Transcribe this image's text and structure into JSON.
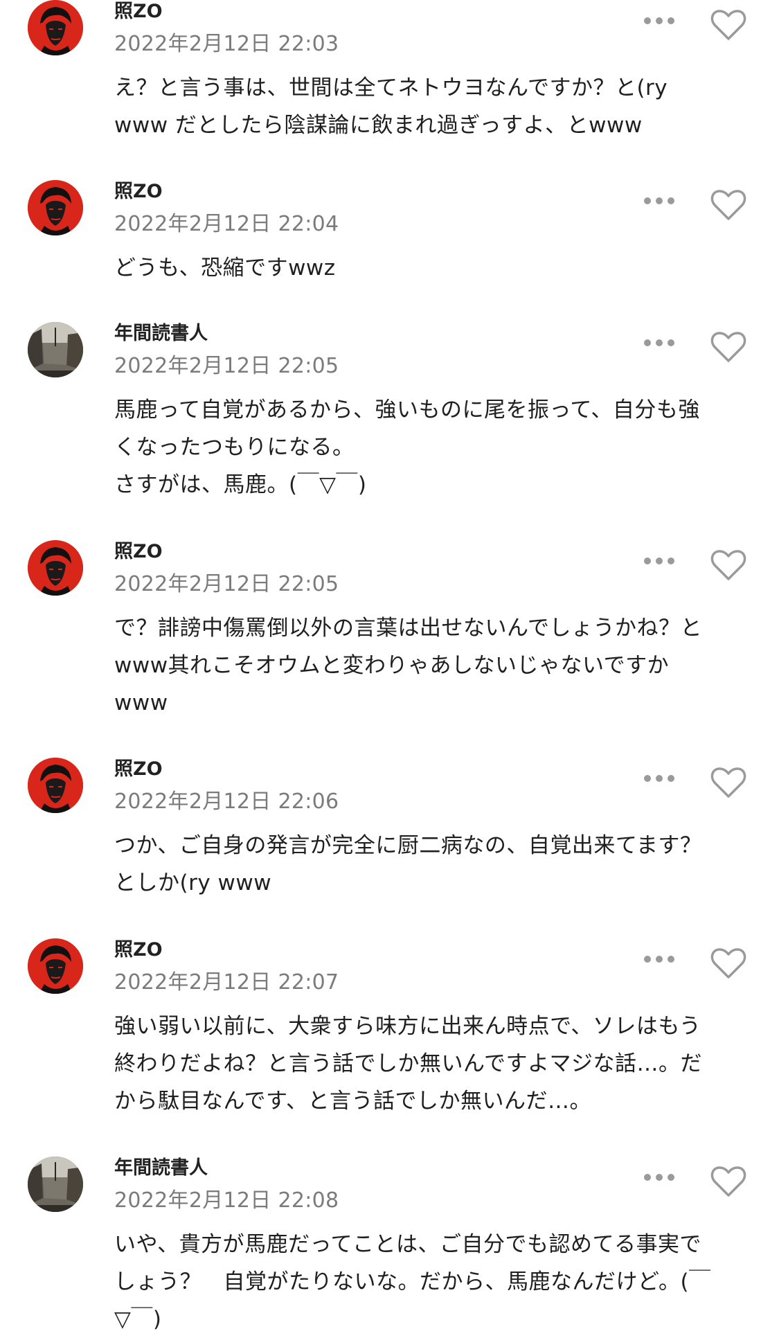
{
  "comments": [
    {
      "username": "照ZO",
      "avatar": "che-portrait-avatar",
      "timestamp": "2022年2月12日 22:03",
      "text": "え？と言う事は、世間は全てネトウヨなんですか？と(ry\nwww だとしたら陰謀論に飲まれ過ぎっすよ、とwww"
    },
    {
      "username": "照ZO",
      "avatar": "che-portrait-avatar",
      "timestamp": "2022年2月12日 22:04",
      "text": "どうも、恐縮ですwwz"
    },
    {
      "username": "年間読書人",
      "avatar": "street-photo-avatar",
      "timestamp": "2022年2月12日 22:05",
      "text": "馬鹿って自覚があるから、強いものに尾を振って、自分も強\nくなったつもりになる。\nさすがは、馬鹿。(￣▽￣)"
    },
    {
      "username": "照ZO",
      "avatar": "che-portrait-avatar",
      "timestamp": "2022年2月12日 22:05",
      "text": "で？誹謗中傷罵倒以外の言葉は出せないんでしょうかね？と\nwww其れこそオウムと変わりゃあしないじゃないですか\nwww"
    },
    {
      "username": "照ZO",
      "avatar": "che-portrait-avatar",
      "timestamp": "2022年2月12日 22:06",
      "text": "つか、ご自身の発言が完全に厨二病なの、自覚出来てます？\nとしか(ry www"
    },
    {
      "username": "照ZO",
      "avatar": "che-portrait-avatar",
      "timestamp": "2022年2月12日 22:07",
      "text": "強い弱い以前に、大衆すら味方に出来ん時点で、ソレはもう\n終わりだよね？と言う話でしか無いんですよマジな話…。だ\nから駄目なんです、と言う話でしか無いんだ…。"
    },
    {
      "username": "年間読書人",
      "avatar": "street-photo-avatar",
      "timestamp": "2022年2月12日 22:08",
      "text": "いや、貴方が馬鹿だってことは、ご自分でも認めてる事実で\nしょう？　自覚がたりないな。だから、馬鹿なんだけど。(￣\n▽￣)"
    }
  ],
  "icons": {
    "more": "more-horizontal-icon",
    "like": "heart-outline-icon"
  },
  "colors": {
    "background": "#ffffff",
    "text": "#1f1f1f",
    "timestamp": "#7b7b7b",
    "icon": "#9a9a9a",
    "avatar_red": "#d8261b"
  }
}
